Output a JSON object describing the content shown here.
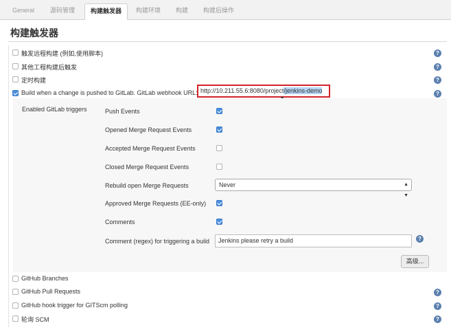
{
  "tabs": [
    "General",
    "源码管理",
    "构建触发器",
    "构建环境",
    "构建",
    "构建后操作"
  ],
  "section_title": "构建触发器",
  "triggers": {
    "remote": {
      "label": "触发远程构建 (例如,使用脚本)",
      "checked": false
    },
    "after_other": {
      "label": "其他工程构建后触发",
      "checked": false
    },
    "scheduled": {
      "label": "定时构建",
      "checked": false
    },
    "gitlab": {
      "label": "Build when a change is pushed to GitLab. GitLab webhook URL:",
      "checked": true,
      "url_prefix": "http://10.211.55.6:8080/project",
      "url_selected": "/jenkins-demo"
    }
  },
  "gitlab_panel": {
    "enabled_label": "Enabled GitLab triggers",
    "push_events": {
      "label": "Push Events",
      "checked": true
    },
    "opened_mr": {
      "label": "Opened Merge Request Events",
      "checked": true
    },
    "accepted_mr": {
      "label": "Accepted Merge Request Events",
      "checked": false
    },
    "closed_mr": {
      "label": "Closed Merge Request Events",
      "checked": false
    },
    "rebuild_open_mr": {
      "label": "Rebuild open Merge Requests",
      "value": "Never"
    },
    "approved_mr": {
      "label": "Approved Merge Requests (EE-only)",
      "checked": true
    },
    "comments": {
      "label": "Comments",
      "checked": true
    },
    "comment_regex": {
      "label": "Comment (regex) for triggering a build",
      "value": "Jenkins please retry a build"
    },
    "advanced_button": "高级..."
  },
  "other_triggers": {
    "github_branches": {
      "label": "GitHub Branches",
      "checked": false
    },
    "github_pr": {
      "label": "GitHub Pull Requests",
      "checked": false
    },
    "github_hook": {
      "label": "GitHub hook trigger for GITScm polling",
      "checked": false
    },
    "poll_scm": {
      "label": "轮询 SCM",
      "checked": false
    }
  },
  "icons": {
    "help": "help-icon",
    "dropdown": "chevron-updown-icon",
    "cursor": "mouse-pointer-icon"
  },
  "colors": {
    "checkbox_checked": "#4a8fde",
    "highlight_border": "#d2232a",
    "help_icon": "#5b7fae",
    "selection": "#b4d4f3"
  }
}
